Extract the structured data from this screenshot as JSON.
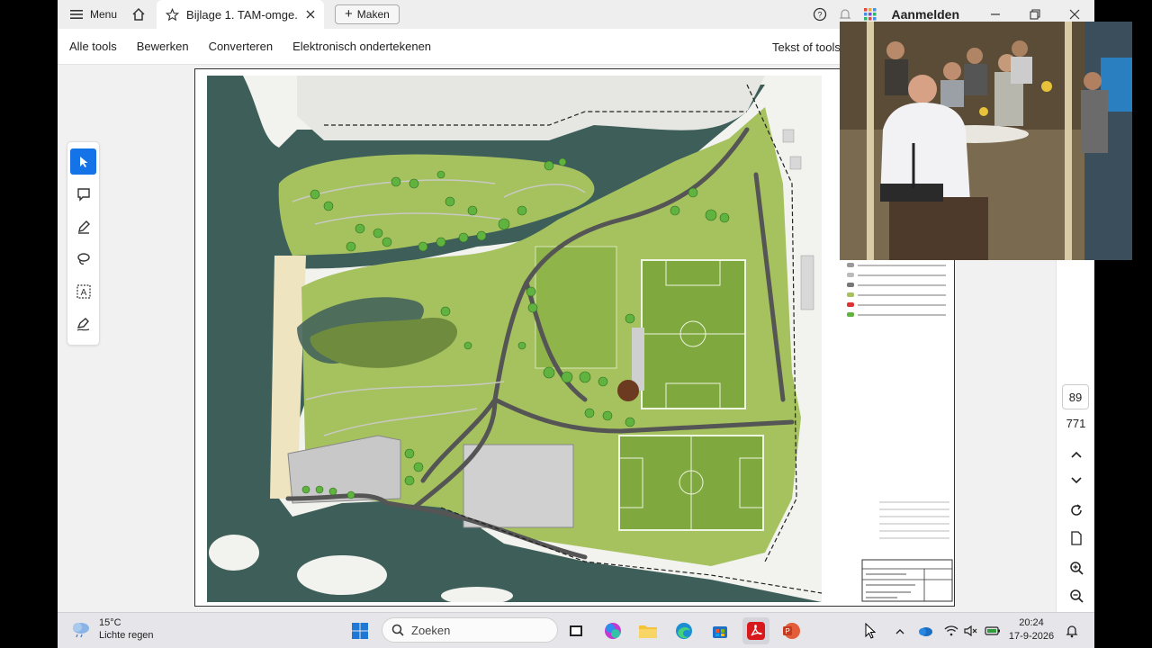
{
  "titlebar": {
    "menu_label": "Menu",
    "tab_title": "Bijlage 1. TAM-omge...",
    "new_button_label": "Maken",
    "signin_label": "Aanmelden"
  },
  "tools": {
    "links": [
      "Alle tools",
      "Bewerken",
      "Converteren",
      "Elektronisch ondertekenen"
    ],
    "text_tools_label": "Tekst of tools"
  },
  "navigation": {
    "current_page": "89",
    "total_pages": "771"
  },
  "taskbar": {
    "temperature": "15°C",
    "weather_desc": "Lichte regen",
    "search_placeholder": "Zoeken",
    "time": "20:24",
    "date": "17-9-2026"
  },
  "colors": {
    "accent": "#1473e6",
    "water": "#3e5e5a",
    "grass": "#a5c25f",
    "field": "#7fa83f",
    "path": "#555555"
  }
}
